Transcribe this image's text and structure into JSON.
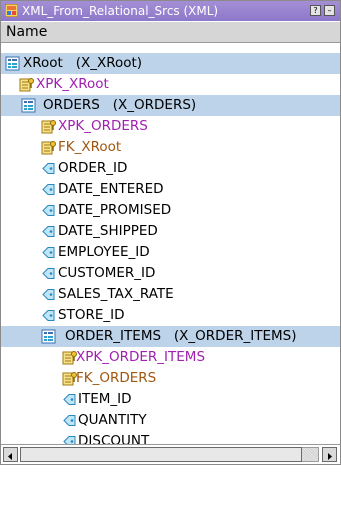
{
  "window": {
    "title": "XML_From_Relational_Srcs (XML)",
    "help_button_label": "?",
    "minimize_button_label": "–"
  },
  "header": {
    "column_name": "Name"
  },
  "tree": {
    "root": {
      "label": "XRoot   (X_XRoot)"
    },
    "xpk_xroot": {
      "label": "XPK_XRoot"
    },
    "orders": {
      "label": "ORDERS   (X_ORDERS)"
    },
    "xpk_orders": {
      "label": "XPK_ORDERS"
    },
    "fk_xroot": {
      "label": "FK_XRoot"
    },
    "order_id": {
      "label": "ORDER_ID"
    },
    "date_entered": {
      "label": "DATE_ENTERED"
    },
    "date_promised": {
      "label": "DATE_PROMISED"
    },
    "date_shipped": {
      "label": "DATE_SHIPPED"
    },
    "employee_id": {
      "label": "EMPLOYEE_ID"
    },
    "customer_id": {
      "label": "CUSTOMER_ID"
    },
    "sales_tax_rate": {
      "label": "SALES_TAX_RATE"
    },
    "store_id": {
      "label": "STORE_ID"
    },
    "order_items": {
      "label": "ORDER_ITEMS   (X_ORDER_ITEMS)"
    },
    "xpk_order_items": {
      "label": "XPK_ORDER_ITEMS"
    },
    "fk_orders": {
      "label": "FK_ORDERS"
    },
    "item_id": {
      "label": "ITEM_ID"
    },
    "quantity": {
      "label": "QUANTITY"
    },
    "discount": {
      "label": "DISCOUNT"
    }
  },
  "scrollbar": {
    "horizontal_position": 0.0
  }
}
